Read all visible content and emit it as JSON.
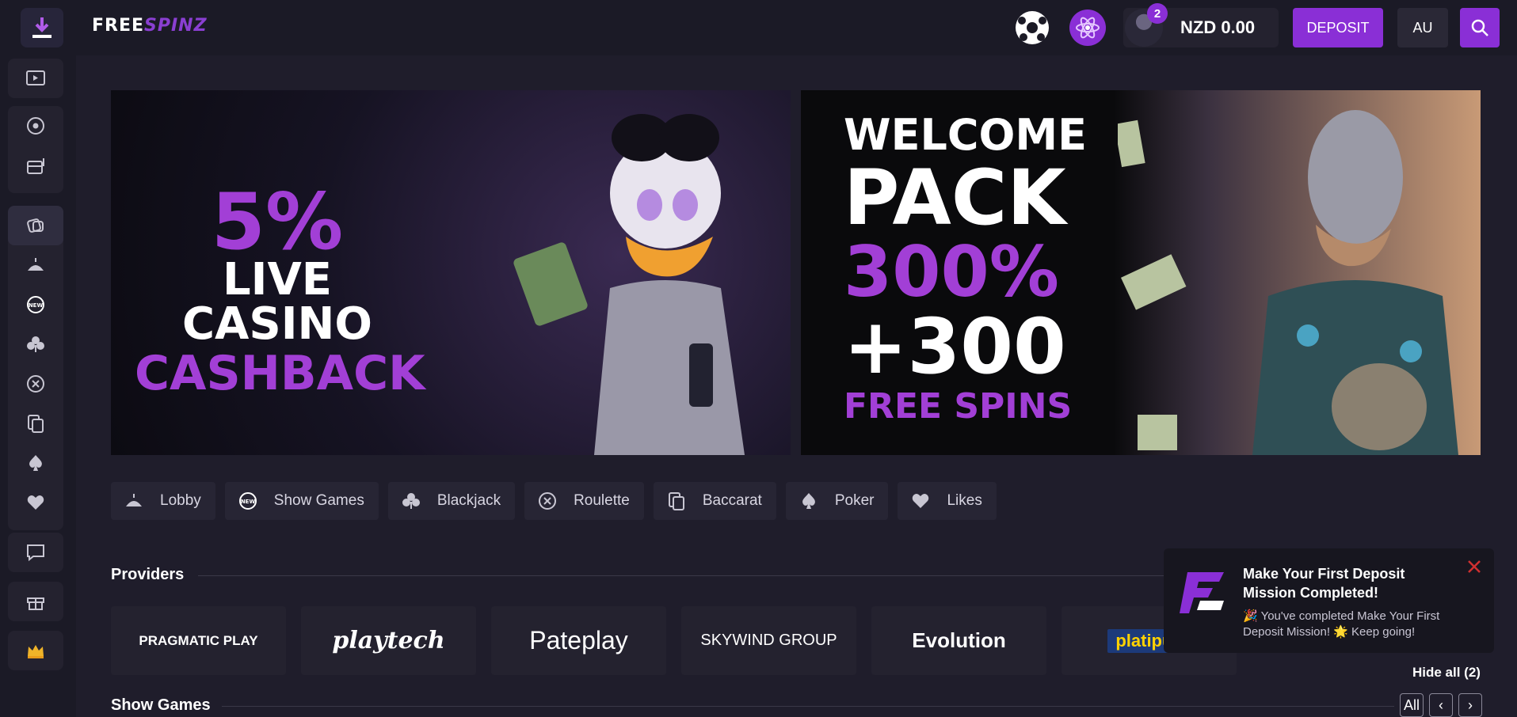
{
  "brand": {
    "part1": "FREE",
    "part2": "SPINZ"
  },
  "header": {
    "balance": "NZD 0.00",
    "notification_count": "2",
    "deposit_label": "DEPOSIT",
    "language": "AU"
  },
  "sidebar": {
    "items": [
      "download-icon",
      "live-tv-icon",
      "sports-icon",
      "slots-icon",
      "casino-icon",
      "lobby-icon",
      "new-icon",
      "blackjack-icon",
      "roulette-icon",
      "baccarat-icon",
      "poker-icon",
      "likes-icon",
      "chat-icon",
      "gift-icon",
      "vip-crown-icon"
    ]
  },
  "banners": {
    "left": {
      "line1": "5%",
      "line2": "LIVE CASINO",
      "line3": "CASHBACK"
    },
    "right": {
      "line1": "WELCOME",
      "line2": "PACK",
      "line3": "300%",
      "line4": "+300",
      "line5": "FREE SPINS"
    }
  },
  "tabs": [
    {
      "label": "Lobby",
      "icon": "lobby-icon"
    },
    {
      "label": "Show Games",
      "icon": "new-icon"
    },
    {
      "label": "Blackjack",
      "icon": "club-icon"
    },
    {
      "label": "Roulette",
      "icon": "roulette-icon"
    },
    {
      "label": "Baccarat",
      "icon": "baccarat-icon"
    },
    {
      "label": "Poker",
      "icon": "spade-icon"
    },
    {
      "label": "Likes",
      "icon": "heart-icon"
    }
  ],
  "sections": {
    "providers_title": "Providers",
    "show_games_title": "Show Games"
  },
  "providers": [
    "PRAGMATIC PLAY",
    "playtech",
    "Pateplay",
    "SKYWIND GROUP",
    "Evolution",
    "platipus"
  ],
  "notification": {
    "title": "Make Your First Deposit Mission Completed!",
    "body": "🎉 You've completed Make Your First Deposit Mission! 🌟 Keep going!"
  },
  "hide_all": "Hide all (2)",
  "pager": {
    "all": "All",
    "prev": "‹",
    "next": "›"
  },
  "colors": {
    "accent": "#8a2fd6",
    "background": "#1f1d2b",
    "panel": "#24222f"
  }
}
